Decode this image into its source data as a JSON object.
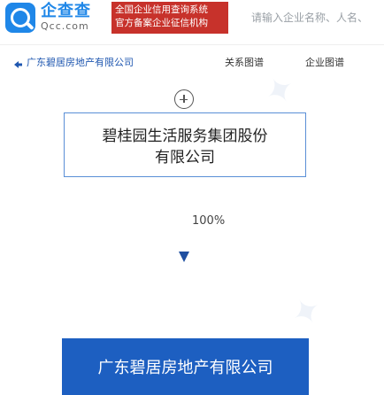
{
  "header": {
    "logo_text": "企查查",
    "logo_domain": "Qcc.com",
    "banner_lines": [
      "全国企业信用查询系统",
      "官方备案企业征信机构"
    ],
    "search_placeholder": "请输入企业名称、人名、"
  },
  "nav": {
    "back_label": "广东碧居房地产有限公司",
    "links": [
      {
        "label": "关系图谱"
      },
      {
        "label": "企业图谱"
      }
    ]
  },
  "tree": {
    "parent_name": "碧桂园生活服务集团股份有限公司",
    "parent_lines": [
      "碧桂园生活服务集团股份",
      "有限公司"
    ],
    "percentage": "100%",
    "target_name": "广东碧居房地产有限公司"
  },
  "colors": {
    "brand_blue": "#1f87e8",
    "banner_red": "#c7322b",
    "target_box": "#1d5fc1",
    "arrow": "#1f4fa0"
  },
  "icons": {
    "back": "back-arrow-icon",
    "expand": "plus-circle-icon",
    "logo": "magnifier-logo-icon"
  }
}
